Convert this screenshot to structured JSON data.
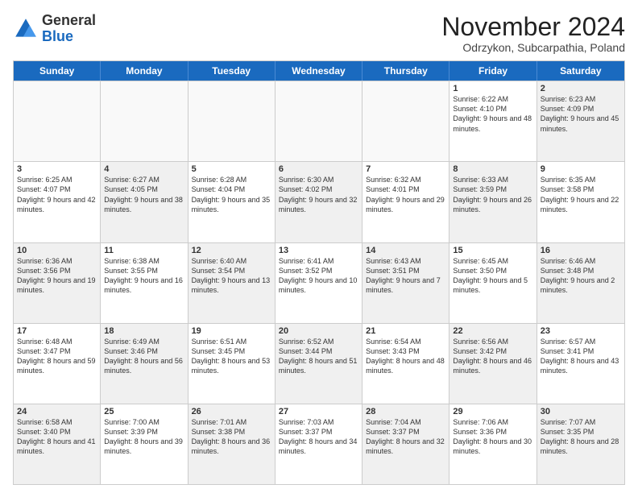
{
  "header": {
    "logo_general": "General",
    "logo_blue": "Blue",
    "month_title": "November 2024",
    "subtitle": "Odrzykon, Subcarpathia, Poland"
  },
  "weekdays": [
    "Sunday",
    "Monday",
    "Tuesday",
    "Wednesday",
    "Thursday",
    "Friday",
    "Saturday"
  ],
  "rows": [
    [
      {
        "day": "",
        "info": "",
        "empty": true
      },
      {
        "day": "",
        "info": "",
        "empty": true
      },
      {
        "day": "",
        "info": "",
        "empty": true
      },
      {
        "day": "",
        "info": "",
        "empty": true
      },
      {
        "day": "",
        "info": "",
        "empty": true
      },
      {
        "day": "1",
        "info": "Sunrise: 6:22 AM\nSunset: 4:10 PM\nDaylight: 9 hours and 48 minutes.",
        "empty": false
      },
      {
        "day": "2",
        "info": "Sunrise: 6:23 AM\nSunset: 4:09 PM\nDaylight: 9 hours and 45 minutes.",
        "empty": false,
        "shaded": true
      }
    ],
    [
      {
        "day": "3",
        "info": "Sunrise: 6:25 AM\nSunset: 4:07 PM\nDaylight: 9 hours and 42 minutes.",
        "empty": false
      },
      {
        "day": "4",
        "info": "Sunrise: 6:27 AM\nSunset: 4:05 PM\nDaylight: 9 hours and 38 minutes.",
        "empty": false,
        "shaded": true
      },
      {
        "day": "5",
        "info": "Sunrise: 6:28 AM\nSunset: 4:04 PM\nDaylight: 9 hours and 35 minutes.",
        "empty": false
      },
      {
        "day": "6",
        "info": "Sunrise: 6:30 AM\nSunset: 4:02 PM\nDaylight: 9 hours and 32 minutes.",
        "empty": false,
        "shaded": true
      },
      {
        "day": "7",
        "info": "Sunrise: 6:32 AM\nSunset: 4:01 PM\nDaylight: 9 hours and 29 minutes.",
        "empty": false
      },
      {
        "day": "8",
        "info": "Sunrise: 6:33 AM\nSunset: 3:59 PM\nDaylight: 9 hours and 26 minutes.",
        "empty": false,
        "shaded": true
      },
      {
        "day": "9",
        "info": "Sunrise: 6:35 AM\nSunset: 3:58 PM\nDaylight: 9 hours and 22 minutes.",
        "empty": false
      }
    ],
    [
      {
        "day": "10",
        "info": "Sunrise: 6:36 AM\nSunset: 3:56 PM\nDaylight: 9 hours and 19 minutes.",
        "empty": false,
        "shaded": true
      },
      {
        "day": "11",
        "info": "Sunrise: 6:38 AM\nSunset: 3:55 PM\nDaylight: 9 hours and 16 minutes.",
        "empty": false
      },
      {
        "day": "12",
        "info": "Sunrise: 6:40 AM\nSunset: 3:54 PM\nDaylight: 9 hours and 13 minutes.",
        "empty": false,
        "shaded": true
      },
      {
        "day": "13",
        "info": "Sunrise: 6:41 AM\nSunset: 3:52 PM\nDaylight: 9 hours and 10 minutes.",
        "empty": false
      },
      {
        "day": "14",
        "info": "Sunrise: 6:43 AM\nSunset: 3:51 PM\nDaylight: 9 hours and 7 minutes.",
        "empty": false,
        "shaded": true
      },
      {
        "day": "15",
        "info": "Sunrise: 6:45 AM\nSunset: 3:50 PM\nDaylight: 9 hours and 5 minutes.",
        "empty": false
      },
      {
        "day": "16",
        "info": "Sunrise: 6:46 AM\nSunset: 3:48 PM\nDaylight: 9 hours and 2 minutes.",
        "empty": false,
        "shaded": true
      }
    ],
    [
      {
        "day": "17",
        "info": "Sunrise: 6:48 AM\nSunset: 3:47 PM\nDaylight: 8 hours and 59 minutes.",
        "empty": false
      },
      {
        "day": "18",
        "info": "Sunrise: 6:49 AM\nSunset: 3:46 PM\nDaylight: 8 hours and 56 minutes.",
        "empty": false,
        "shaded": true
      },
      {
        "day": "19",
        "info": "Sunrise: 6:51 AM\nSunset: 3:45 PM\nDaylight: 8 hours and 53 minutes.",
        "empty": false
      },
      {
        "day": "20",
        "info": "Sunrise: 6:52 AM\nSunset: 3:44 PM\nDaylight: 8 hours and 51 minutes.",
        "empty": false,
        "shaded": true
      },
      {
        "day": "21",
        "info": "Sunrise: 6:54 AM\nSunset: 3:43 PM\nDaylight: 8 hours and 48 minutes.",
        "empty": false
      },
      {
        "day": "22",
        "info": "Sunrise: 6:56 AM\nSunset: 3:42 PM\nDaylight: 8 hours and 46 minutes.",
        "empty": false,
        "shaded": true
      },
      {
        "day": "23",
        "info": "Sunrise: 6:57 AM\nSunset: 3:41 PM\nDaylight: 8 hours and 43 minutes.",
        "empty": false
      }
    ],
    [
      {
        "day": "24",
        "info": "Sunrise: 6:58 AM\nSunset: 3:40 PM\nDaylight: 8 hours and 41 minutes.",
        "empty": false,
        "shaded": true
      },
      {
        "day": "25",
        "info": "Sunrise: 7:00 AM\nSunset: 3:39 PM\nDaylight: 8 hours and 39 minutes.",
        "empty": false
      },
      {
        "day": "26",
        "info": "Sunrise: 7:01 AM\nSunset: 3:38 PM\nDaylight: 8 hours and 36 minutes.",
        "empty": false,
        "shaded": true
      },
      {
        "day": "27",
        "info": "Sunrise: 7:03 AM\nSunset: 3:37 PM\nDaylight: 8 hours and 34 minutes.",
        "empty": false
      },
      {
        "day": "28",
        "info": "Sunrise: 7:04 AM\nSunset: 3:37 PM\nDaylight: 8 hours and 32 minutes.",
        "empty": false,
        "shaded": true
      },
      {
        "day": "29",
        "info": "Sunrise: 7:06 AM\nSunset: 3:36 PM\nDaylight: 8 hours and 30 minutes.",
        "empty": false
      },
      {
        "day": "30",
        "info": "Sunrise: 7:07 AM\nSunset: 3:35 PM\nDaylight: 8 hours and 28 minutes.",
        "empty": false,
        "shaded": true
      }
    ]
  ]
}
